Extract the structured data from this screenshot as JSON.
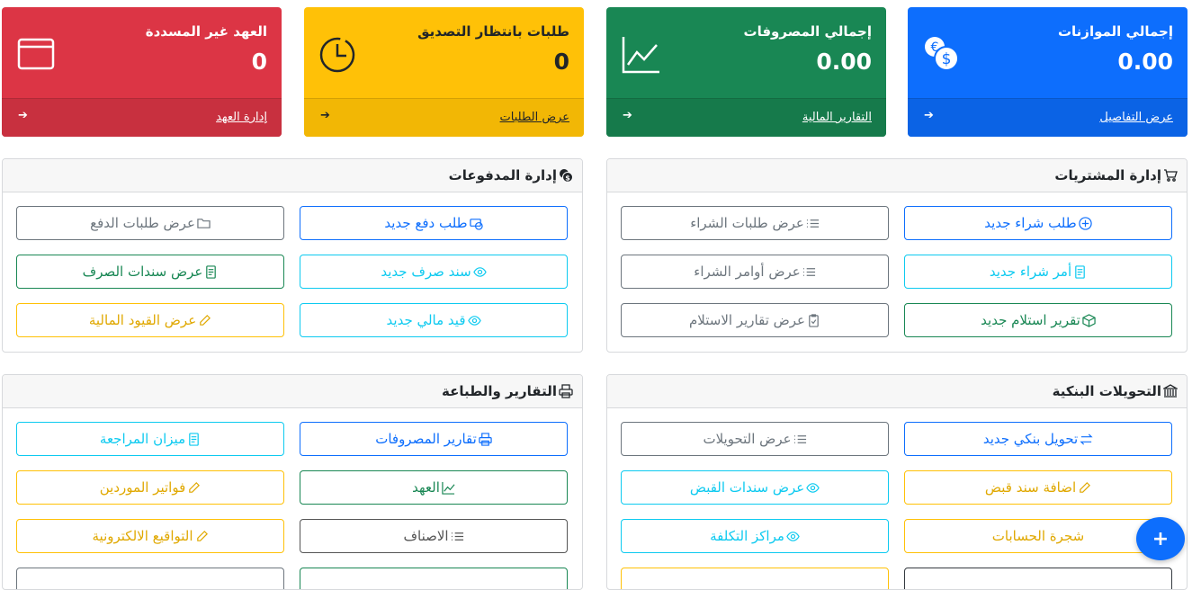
{
  "stats": {
    "budgets": {
      "title": "إجمالي الموازنات",
      "value": "0.00",
      "link": "عرض التفاصيل",
      "color": "#0d6efd"
    },
    "expenses": {
      "title": "إجمالي المصروفات",
      "value": "0.00",
      "link": "التقارير المالية",
      "color": "#198754"
    },
    "pending": {
      "title": "طلبات بانتظار التصديق",
      "value": "0",
      "link": "عرض الطلبات",
      "color": "#ffc107"
    },
    "custody": {
      "title": "العهد غير المسددة",
      "value": "0",
      "link": "إدارة العهد",
      "color": "#dc3545"
    },
    "arrow": "➔"
  },
  "purchases": {
    "title": "إدارة المشتريات",
    "new_request": "طلب شراء جديد",
    "view_requests": "عرض طلبات الشراء",
    "new_order": "أمر شراء جديد",
    "view_orders": "عرض أوامر الشراء",
    "new_receipt": "تقرير استلام جديد",
    "view_receipts": "عرض تقارير الاستلام"
  },
  "payments": {
    "title": "إدارة المدفوعات",
    "new_payment": "طلب دفع جديد",
    "view_payments": "عرض طلبات الدفع",
    "new_voucher": "سند صرف جديد",
    "view_vouchers": "عرض سندات الصرف",
    "new_entry": "قيد مالي جديد",
    "view_entries": "عرض القيود المالية"
  },
  "transfers": {
    "title": "التحويلات البنكية",
    "new_transfer": "تحويل بنكي جديد",
    "view_transfers": "عرض التحويلات",
    "add_receipt": "اضافة سند قبض",
    "view_receipts": "عرض سندات القبض",
    "accounts_tree": "شجرة الحسابات",
    "cost_centers": "مراكز التكلفة"
  },
  "reports": {
    "title": "التقارير والطباعة",
    "expense_reports": "تقارير المصروفات",
    "trial_balance": "ميزان المراجعة",
    "custody": "العهد",
    "supplier_invoices": "فواتير الموردين",
    "categories": "الاصناف",
    "e_signatures": "التواقيع الالكترونية"
  },
  "fab": "+"
}
